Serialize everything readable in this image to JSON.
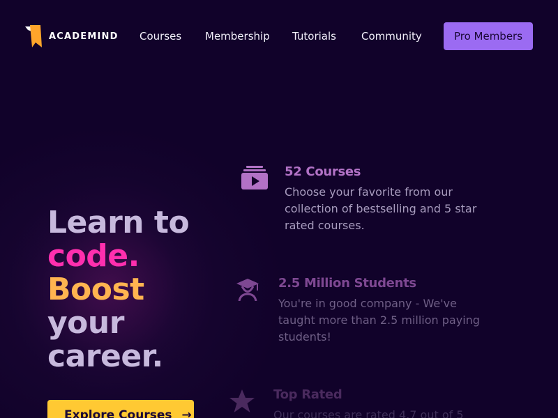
{
  "header": {
    "logo_text": "ACADEMIND",
    "nav": {
      "courses": "Courses",
      "membership": "Membership",
      "tutorials": "Tutorials",
      "community": "Community"
    },
    "pro_button": "Pro Members"
  },
  "hero": {
    "line1": "Learn to",
    "line2": "code.",
    "line3": "Boost",
    "line4": "your",
    "line5": "career.",
    "cta_label": "Explore Courses",
    "cta_arrow": "→"
  },
  "features": {
    "courses": {
      "icon": "video-play-icon",
      "title": "52 Courses",
      "desc": "Choose your favorite from our collection of bestselling and 5 star rated courses."
    },
    "students": {
      "icon": "graduate-student-icon",
      "title": "2.5 Million Students",
      "desc": "You're in good company - We've taught more than 2.5 million paying students!"
    },
    "rated": {
      "icon": "star-icon",
      "title": "Top Rated",
      "desc": "Our courses are rated 4.7 out of 5"
    }
  },
  "colors": {
    "background": "#12032a",
    "accent_purple": "#9b6bf2",
    "accent_pink": "#ff2fae",
    "accent_orange": "#ffb450",
    "cta_yellow": "#ffc933"
  }
}
